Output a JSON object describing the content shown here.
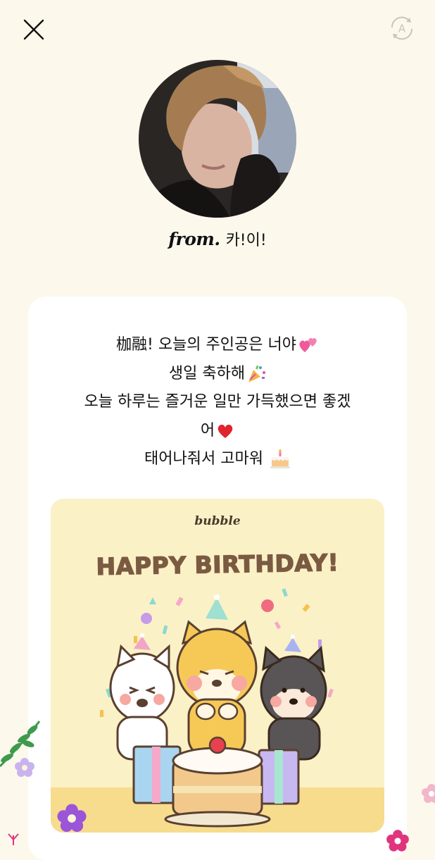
{
  "header": {
    "close_icon": "close-icon",
    "translate_icon": "auto-translate-icon"
  },
  "profile": {
    "from_prefix": "from.",
    "sender_name": "카!이!"
  },
  "message": {
    "lines": [
      "枷融! 오늘의 주인공은 너야",
      "생일 축하해",
      "오늘 하루는 즐거운 일만 가득했으면 좋겠",
      "어",
      "태어나줘서 고마워 "
    ]
  },
  "birthday_card": {
    "brand": "bubble",
    "headline": "HAPPY BIRTHDAY!"
  },
  "colors": {
    "background": "#fcf8ec",
    "card": "#ffffff",
    "birthday_card_bg": "#fbf1c6",
    "headline_brown": "#7b5a42"
  }
}
